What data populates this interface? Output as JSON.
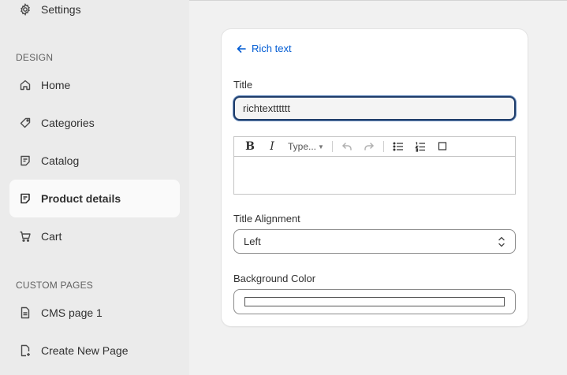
{
  "sidebar": {
    "settings_label": "Settings",
    "design_section": "DESIGN",
    "design_items": [
      {
        "label": "Home",
        "icon": "home-icon"
      },
      {
        "label": "Categories",
        "icon": "tag-icon"
      },
      {
        "label": "Catalog",
        "icon": "catalog-icon"
      },
      {
        "label": "Product details",
        "icon": "product-details-icon",
        "active": true
      },
      {
        "label": "Cart",
        "icon": "cart-icon"
      }
    ],
    "custom_section": "CUSTOM PAGES",
    "custom_items": [
      {
        "label": "CMS page 1",
        "icon": "page-icon"
      },
      {
        "label": "Create New Page",
        "icon": "page-add-icon"
      }
    ]
  },
  "panel": {
    "back_label": "Rich text",
    "title_label": "Title",
    "title_value": "richtextttttt",
    "editor": {
      "bold": "B",
      "italic": "I",
      "type_select": "Type..."
    },
    "alignment_label": "Title Alignment",
    "alignment_value": "Left",
    "background_label": "Background Color",
    "background_value": "#ffffff"
  },
  "colors": {
    "accent": "#005bd3",
    "active_bg": "#fafafa",
    "sidebar_bg": "#ebebeb",
    "page_bg": "#f1f1f1"
  }
}
